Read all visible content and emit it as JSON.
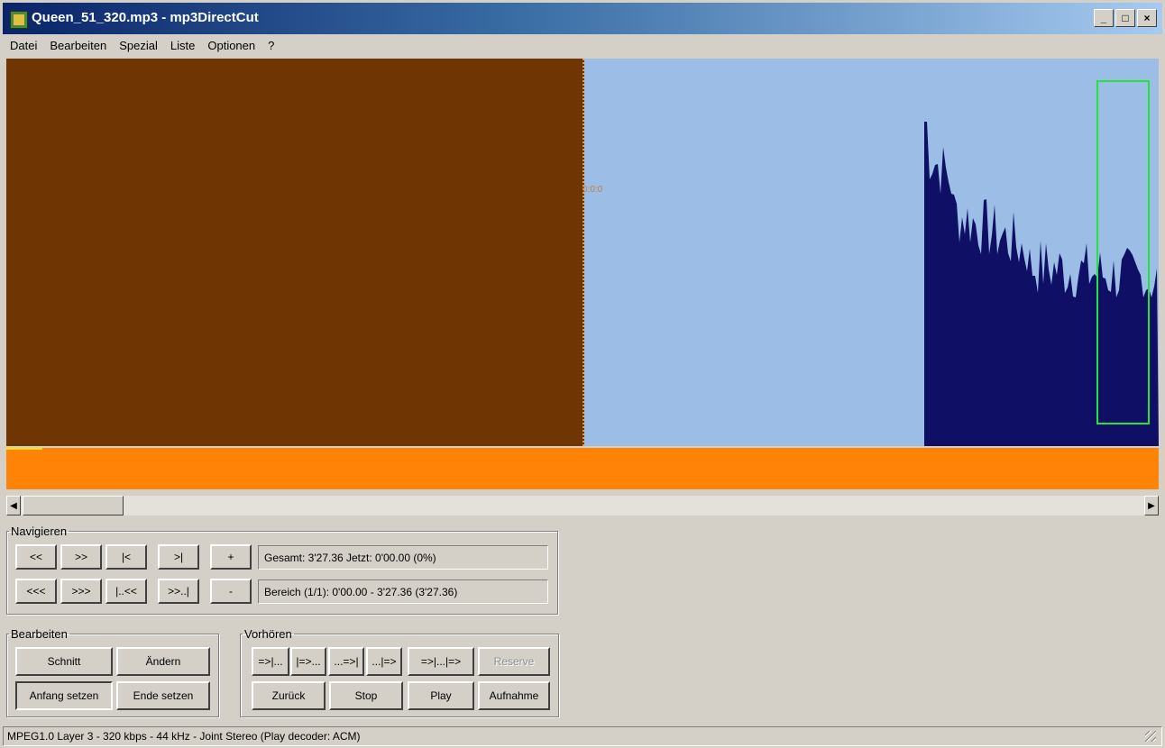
{
  "window": {
    "title": "Queen_51_320.mp3 - mp3DirectCut",
    "minimize": "_",
    "maximize": "□",
    "close": "×"
  },
  "menu": [
    "Datei",
    "Bearbeiten",
    "Spezial",
    "Liste",
    "Optionen",
    "?"
  ],
  "colors": {
    "played": "#6f3603",
    "wave_bg": "#9cbde5",
    "waveform": "#0f0f66",
    "selection": "#21e63a",
    "overview": "#ff8307"
  },
  "wave": {
    "cursor_label": "0:0:0"
  },
  "scrollbar": {
    "left_arrow": "◀",
    "right_arrow": "▶"
  },
  "navigate": {
    "legend": "Navigieren",
    "row1": [
      "<<",
      ">>",
      "|<",
      ">|",
      "+"
    ],
    "row2": [
      "<<<",
      ">>>",
      "|..<<",
      ">>..|",
      "-"
    ],
    "total_info": "Gesamt: 3'27.36   Jetzt: 0'00.00   (0%)",
    "range_info": "Bereich (1/1): 0'00.00 - 3'27.36 (3'27.36)"
  },
  "edit": {
    "legend": "Bearbeiten",
    "cut": "Schnitt",
    "change": "Ändern",
    "set_start": "Anfang setzen",
    "set_end": "Ende setzen"
  },
  "preview": {
    "legend": "Vorhören",
    "row1": [
      "=>|...",
      "|=>...",
      "...=>|",
      "...|=>",
      "=>|...|=>",
      "Reserve"
    ],
    "back": "Zurück",
    "stop": "Stop",
    "play": "Play",
    "record": "Aufnahme"
  },
  "status": "MPEG1.0 Layer 3 - 320 kbps - 44 kHz - Joint Stereo    (Play decoder: ACM)"
}
